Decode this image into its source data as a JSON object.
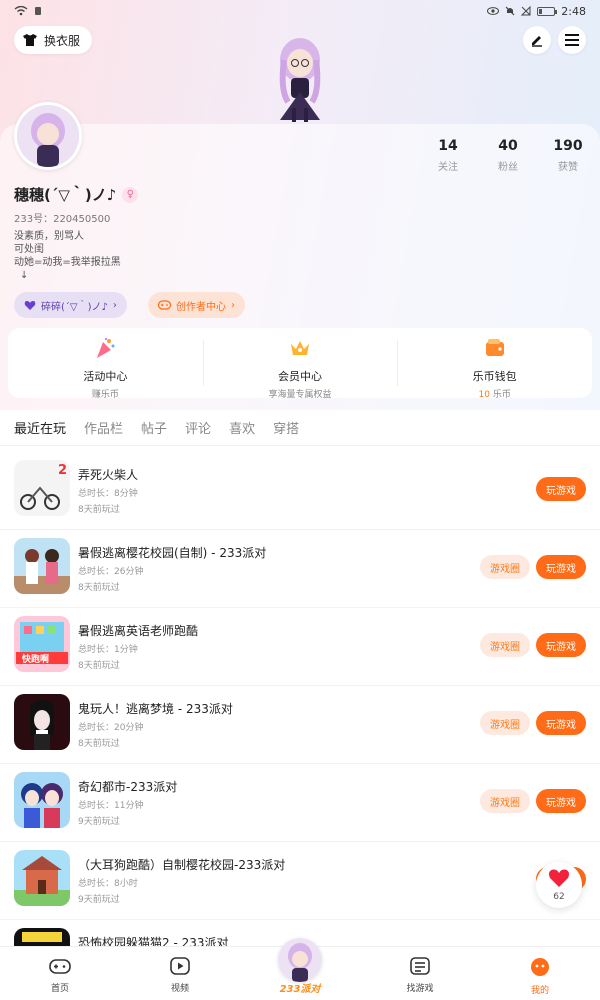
{
  "status_bar": {
    "time": "2:48"
  },
  "header": {
    "outfit_button": "换衣服",
    "edit_icon": "pencil-icon",
    "menu_icon": "hamburger-icon"
  },
  "profile": {
    "nickname": "穗穗(´▽｀)ノ♪",
    "gender_symbol": "♀",
    "uid": "233号：220450500",
    "bio_lines": [
      "没素质，别骂人",
      "可处闺",
      "动她=动我=我举报拉黑",
      "↓"
    ],
    "stats": [
      {
        "value": "14",
        "label": "关注"
      },
      {
        "value": "40",
        "label": "粉丝"
      },
      {
        "value": "190",
        "label": "获赞"
      }
    ],
    "tag_pill": "碎碎(´▽｀)ノ♪",
    "creator_pill": "创作者中心"
  },
  "quick_actions": [
    {
      "title": "活动中心",
      "sub": "赚乐币",
      "sub_highlight": ""
    },
    {
      "title": "会员中心",
      "sub": "享海量专属权益",
      "sub_highlight": ""
    },
    {
      "title": "乐币钱包",
      "sub": "乐币",
      "sub_highlight": "10"
    }
  ],
  "tabs": [
    "最近在玩",
    "作品栏",
    "帖子",
    "评论",
    "喜欢",
    "穿搭"
  ],
  "labels": {
    "play": "玩游戏",
    "circle": "游戏圈"
  },
  "games": [
    {
      "name": "弄死火柴人",
      "duration": "总时长：8分钟",
      "last": "8天前玩过",
      "has_circle": false
    },
    {
      "name": "暑假逃离樱花校园(自制) - 233派对",
      "duration": "总时长：26分钟",
      "last": "8天前玩过",
      "has_circle": true
    },
    {
      "name": "暑假逃离英语老师跑酷",
      "duration": "总时长：1分钟",
      "last": "8天前玩过",
      "has_circle": true
    },
    {
      "name": "鬼玩人！逃离梦境 - 233派对",
      "duration": "总时长：20分钟",
      "last": "8天前玩过",
      "has_circle": true
    },
    {
      "name": "奇幻都市-233派对",
      "duration": "总时长：11分钟",
      "last": "9天前玩过",
      "has_circle": true
    },
    {
      "name": "（大耳狗跑酷）自制樱花校园-233派对",
      "duration": "总时长：8小时",
      "last": "9天前玩过",
      "has_circle": true
    },
    {
      "name": "恐怖校园躲猫猫2 - 233派对",
      "duration": "",
      "last": "",
      "has_circle": true
    }
  ],
  "float_like": {
    "count": "62"
  },
  "bottom_nav": [
    {
      "label": "首页",
      "icon": "gamepad-icon"
    },
    {
      "label": "视频",
      "icon": "video-play-icon"
    },
    {
      "label": "233派对",
      "icon": "party-avatar-icon"
    },
    {
      "label": "找游戏",
      "icon": "list-icon"
    },
    {
      "label": "我的",
      "icon": "profile-face-icon"
    }
  ],
  "colors": {
    "accent": "#ff6b16",
    "soft_accent": "#fde9df",
    "purple_pill": "#e7e0f5"
  }
}
